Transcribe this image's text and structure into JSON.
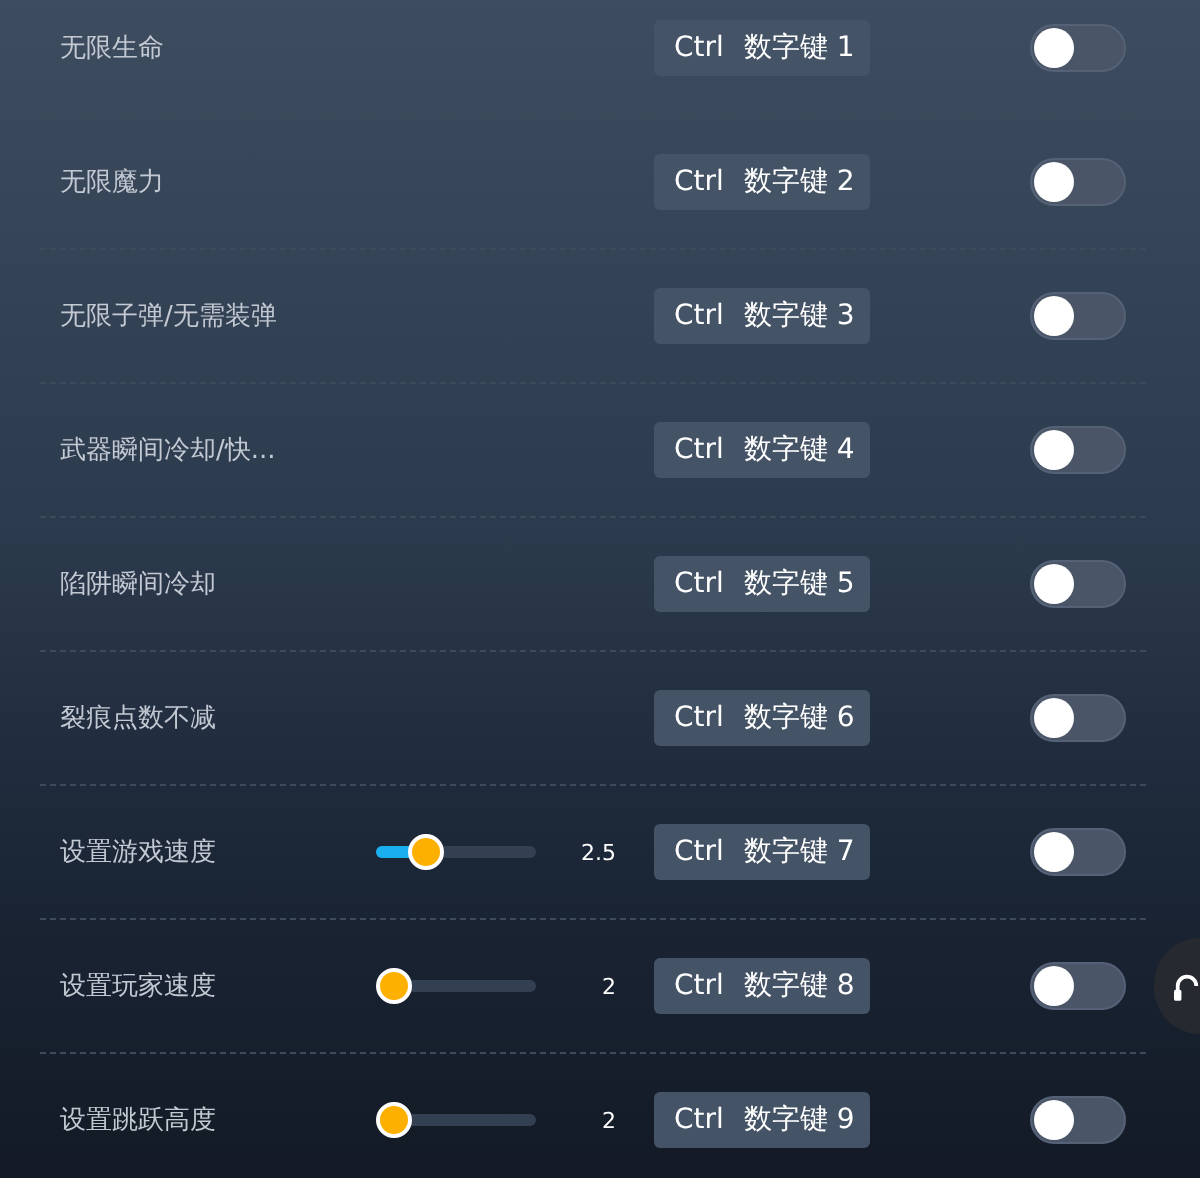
{
  "rows": [
    {
      "kind": "toggle",
      "label": "无限生命",
      "hotkey": {
        "modifier": "Ctrl",
        "key": "数字键 1"
      },
      "on": false
    },
    {
      "kind": "toggle",
      "label": "无限魔力",
      "hotkey": {
        "modifier": "Ctrl",
        "key": "数字键 2"
      },
      "on": false
    },
    {
      "kind": "toggle",
      "label": "无限子弹/无需装弹",
      "hotkey": {
        "modifier": "Ctrl",
        "key": "数字键 3"
      },
      "on": false
    },
    {
      "kind": "toggle",
      "label": "武器瞬间冷却/快...",
      "hotkey": {
        "modifier": "Ctrl",
        "key": "数字键 4"
      },
      "on": false
    },
    {
      "kind": "toggle",
      "label": "陷阱瞬间冷却",
      "hotkey": {
        "modifier": "Ctrl",
        "key": "数字键 5"
      },
      "on": false
    },
    {
      "kind": "toggle",
      "label": "裂痕点数不减",
      "hotkey": {
        "modifier": "Ctrl",
        "key": "数字键 6"
      },
      "on": false
    },
    {
      "kind": "slider",
      "label": "设置游戏速度",
      "level": 0.25,
      "reading": "2.5",
      "hotkey": {
        "modifier": "Ctrl",
        "key": "数字键 7"
      },
      "on": false
    },
    {
      "kind": "slider",
      "label": "设置玩家速度",
      "level": 0,
      "reading": "2",
      "hotkey": {
        "modifier": "Ctrl",
        "key": "数字键 8"
      },
      "on": false
    },
    {
      "kind": "slider",
      "label": "设置跳跃高度",
      "level": 0,
      "reading": "2",
      "hotkey": {
        "modifier": "Ctrl",
        "key": "数字键 9"
      },
      "on": false
    }
  ]
}
